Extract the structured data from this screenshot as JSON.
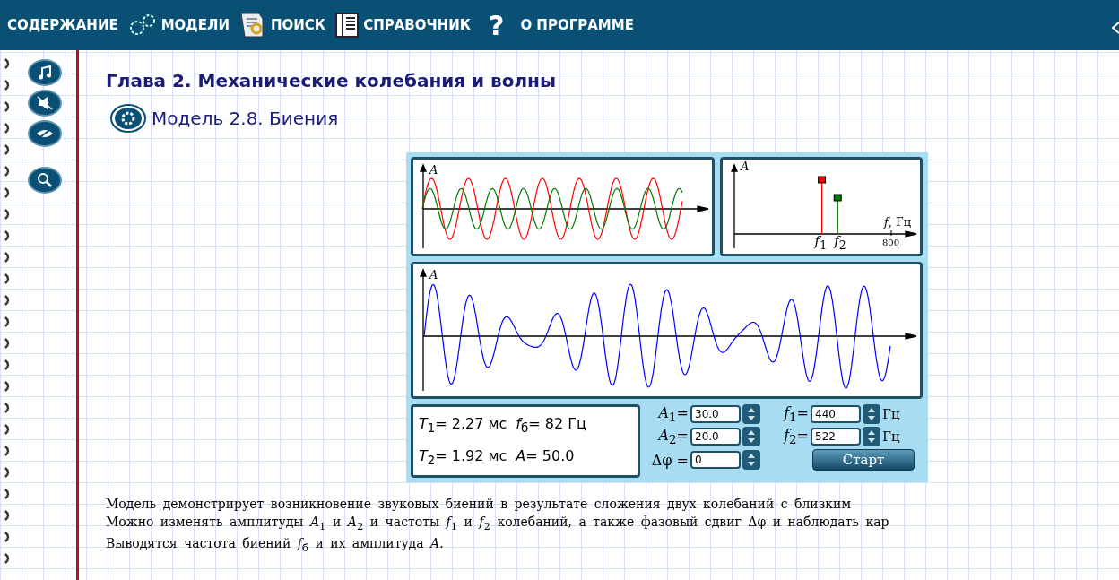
{
  "nav": {
    "items": [
      {
        "kind": "text",
        "label": "СОДЕРЖАНИЕ"
      },
      {
        "kind": "gears",
        "label": "МОДЕЛИ"
      },
      {
        "kind": "search",
        "label": "ПОИСК"
      },
      {
        "kind": "book",
        "label": "СПРАВОЧНИК"
      },
      {
        "kind": "help",
        "icon": "?",
        "label": "О ПРОГРАММЕ"
      }
    ]
  },
  "side_buttons": [
    {
      "kind": "music"
    },
    {
      "kind": "mute"
    },
    {
      "kind": "lips"
    },
    {
      "kind": "zoom"
    }
  ],
  "chapter_title": "Глава 2. Механические колебания и волны",
  "model_title": "Модель 2.8.  Биения",
  "model": {
    "oscillations_chart": {
      "axis_label": "*A*"
    },
    "spectrum_chart": {
      "axis_label": "*A*",
      "x_label": "*f*, Гц",
      "tick": "800",
      "f1_label": "*f*$_{1}$",
      "f2_label": "*f*$_{2}$"
    },
    "beats_chart": {
      "axis_label": "*A*"
    },
    "readouts": [
      [
        "*T*$_{1}$= 2.27 мс",
        "*f*$_{б}$= 82 Гц"
      ],
      [
        "*T*$_{2}$= 1.92 мс",
        "*A*= 50.0"
      ]
    ],
    "controls": [
      {
        "label": "*A*$_{1}$=",
        "value": "30.0",
        "label2": "*f*$_{1}$=",
        "value2": "440",
        "unit": "Гц"
      },
      {
        "label": "*A*$_{2}$=",
        "value": "20.0",
        "label2": "*f*$_{2}$=",
        "value2": "522",
        "unit": "Гц"
      },
      {
        "label": "Δφ =",
        "value": "0",
        "button": "Старт"
      }
    ]
  },
  "description": [
    "Модель демонстрирует возникновение звуковых биений в результате сложения двух колебаний с близким",
    "Можно изменять амплитуды *A*$_{1}$ и *A*$_{2}$ и частоты *f*$_{1}$ и *f*$_{2}$ колебаний, а также фазовый сдвиг Δφ и наблюдать кар",
    "Выводятся частота биений *f*$_{б}$ и их амплитуда *A*."
  ]
}
